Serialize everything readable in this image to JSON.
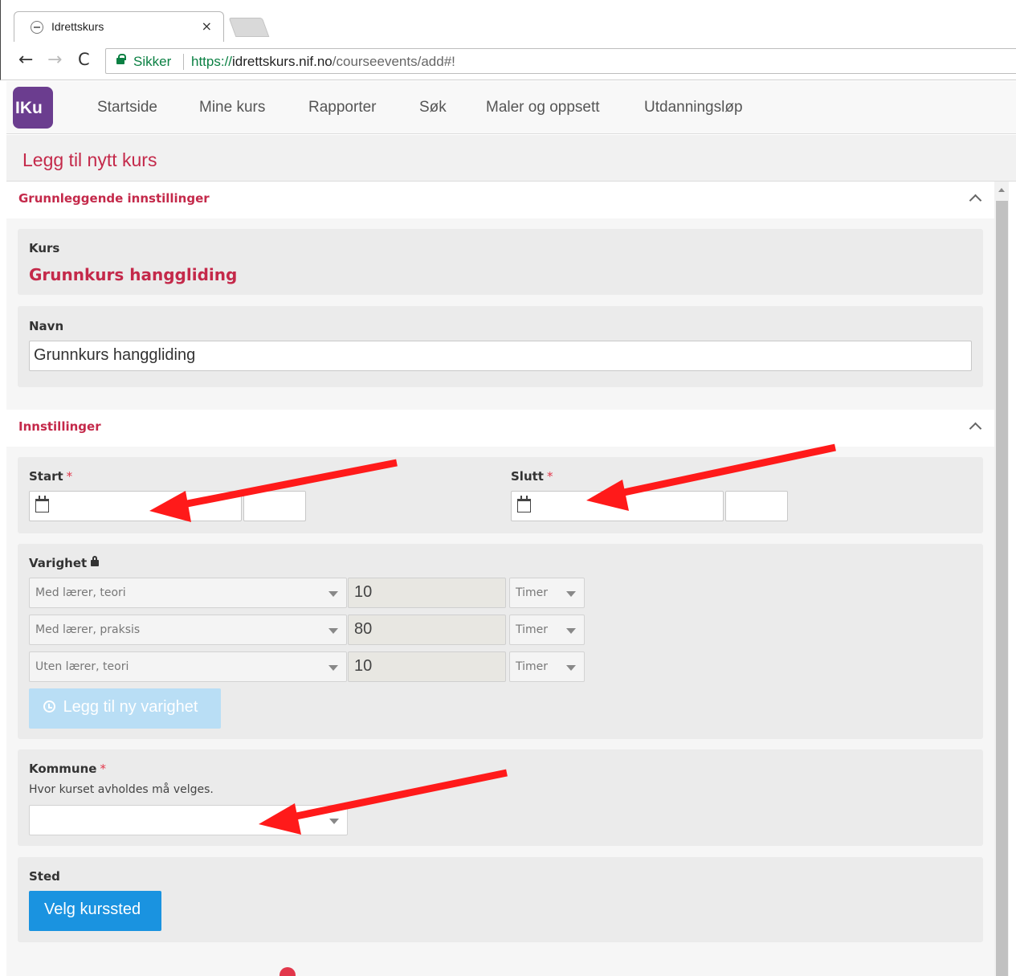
{
  "browser": {
    "tab_title": "Idrettskurs",
    "tab_close": "×",
    "back": "←",
    "forward": "→",
    "reload": "C",
    "secure_label": "Sikker",
    "url_scheme": "https://",
    "url_host": "idrettskurs.nif.no",
    "url_path": "/courseevents/add#!"
  },
  "app": {
    "logo_text": "IKu",
    "logo_color": "#6b3d8f",
    "accent_color": "#c4294a",
    "nav": [
      "Startside",
      "Mine kurs",
      "Rapporter",
      "Søk",
      "Maler og oppsett",
      "Utdanningsløp"
    ]
  },
  "page": {
    "title": "Legg til nytt kurs"
  },
  "basic": {
    "section_title": "Grunnleggende innstillinger",
    "kurs_label": "Kurs",
    "kurs_value": "Grunnkurs hanggliding",
    "navn_label": "Navn",
    "navn_value": "Grunnkurs hanggliding"
  },
  "settings": {
    "section_title": "Innstillinger",
    "start_label": "Start",
    "slutt_label": "Slutt",
    "required_mark": "*",
    "start_date": "",
    "start_time": "",
    "end_date": "",
    "end_time": "",
    "duration_label": "Varighet",
    "durations": [
      {
        "type": "Med lærer, teori",
        "value": "10",
        "unit": "Timer"
      },
      {
        "type": "Med lærer, praksis",
        "value": "80",
        "unit": "Timer"
      },
      {
        "type": "Uten lærer, teori",
        "value": "10",
        "unit": "Timer"
      }
    ],
    "add_duration_label": "Legg til ny varighet",
    "kommune_label": "Kommune",
    "kommune_help": "Hvor kurset avholdes må velges.",
    "kommune_value": "",
    "sted_label": "Sted",
    "sted_button": "Velg kurssted"
  },
  "annotation_color": "#ff1a1a"
}
